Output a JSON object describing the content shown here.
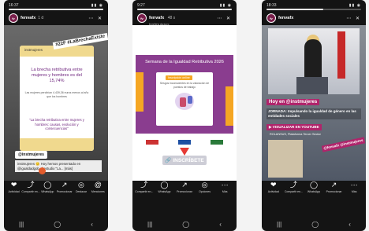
{
  "phones": [
    {
      "status_time": "16:37",
      "status_icons": "▮▮ ◉",
      "account": "fenvafx",
      "account_initials": "fv",
      "time_ago": "1 d",
      "header_icons": "⋯ ✕",
      "card_brand": "instmujeres",
      "tag": "#22F #LaBrechaExiste",
      "card_title": "La brecha retributiva entre mujeres y hombres es del 15,74%",
      "card_body": "Las mujeres percibían 4.439,36 euros menos al año que los hombres",
      "card_quote": "\"La brecha retributiva entre mujeres y hombres: causas, evolución y consecuencias\"",
      "mention": "@instmujeres",
      "caption": "instmujeres 😊 Hoy hemos presentado en @igualdadgob el estudio \"La... [más]",
      "actions": [
        {
          "icon": "❤",
          "label": "Actividad"
        },
        {
          "icon": "⤴",
          "label": "Compartir en..."
        },
        {
          "icon": "◯",
          "label": "WhatsApp"
        },
        {
          "icon": "↗",
          "label": "Promocionar"
        },
        {
          "icon": "◎",
          "label": "Destacar"
        },
        {
          "icon": "@",
          "label": "Menciones"
        }
      ],
      "nav": [
        "|||",
        "◯",
        "‹"
      ]
    },
    {
      "status_time": "9:27",
      "status_icons": "▮▮ ◉",
      "account": "fenvafx",
      "account_initials": "fv",
      "time_ago": "48 s",
      "header_icons": "⋯ ✕",
      "sub_account": "instmujeres",
      "banner_title": "Semana de la Igualdad Retributiva 2026",
      "badge": "Inscripción online",
      "banner_text": "Sesgos inconscientes en la valoración de puestos de trabajo",
      "cta": "INSCRÍBETE",
      "actions": [
        {
          "icon": "⤴",
          "label": "Compartir en..."
        },
        {
          "icon": "◯",
          "label": "WhatsApp"
        },
        {
          "icon": "↗",
          "label": "Promocionar"
        },
        {
          "icon": "◎",
          "label": "Opciones"
        },
        {
          "icon": "⋯",
          "label": "Más"
        }
      ],
      "nav": [
        "|||",
        "◯",
        "‹"
      ]
    },
    {
      "status_time": "18:33",
      "status_icons": "▮▮ ◉",
      "account": "fenvafx",
      "account_initials": "fv",
      "time_ago": "",
      "header_icons": "⋯ ✕",
      "t_hoy": "Hoy en @instmujeres",
      "t_jornada": "JORNADA: Impulsando la igualdad de género en las entidades sociales",
      "t_youtube": "▶ VISUALIZAR EN YOUTUBE",
      "t_date": "ROLANSUS, Plataforma Tercer Sector",
      "tag3": "@fenvafx @instmujeres",
      "actions": [
        {
          "icon": "❤",
          "label": "Actividad"
        },
        {
          "icon": "⤴",
          "label": "Compartir en..."
        },
        {
          "icon": "◯",
          "label": "WhatsApp"
        },
        {
          "icon": "↗",
          "label": "Promocionar"
        },
        {
          "icon": "⋯",
          "label": "Más"
        }
      ],
      "bottom_icons": [
        "✕",
        "⟲",
        "#",
        "✦",
        "…"
      ],
      "nav": [
        "|||",
        "◯",
        "‹"
      ]
    }
  ]
}
